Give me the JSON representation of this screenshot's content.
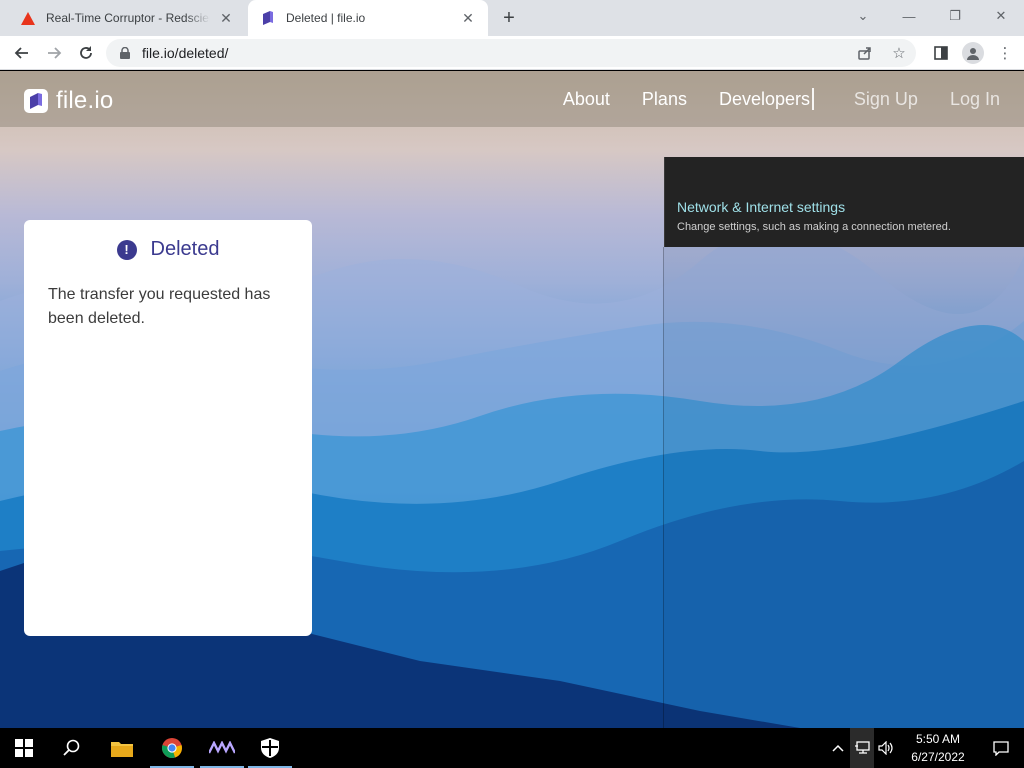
{
  "browser": {
    "tabs": [
      {
        "title": "Real-Time Corruptor - Redscientist",
        "favicon": "warning-triangle-icon",
        "active": false
      },
      {
        "title": "Deleted | file.io",
        "favicon": "fileio-favicon-icon",
        "active": true
      }
    ],
    "url": "file.io/deleted/"
  },
  "site": {
    "logo_text": "file.io",
    "nav": {
      "about": "About",
      "plans": "Plans",
      "developers": "Developers",
      "signup": "Sign Up",
      "login": "Log In"
    }
  },
  "card": {
    "title": "Deleted",
    "message": "The transfer you requested has been deleted."
  },
  "flyout": {
    "title": "Network & Internet settings",
    "description": "Change settings, such as making a connection metered."
  },
  "taskbar": {
    "time": "5:50 AM",
    "date": "6/27/2022",
    "apps": [
      "file-explorer-icon",
      "chrome-icon",
      "corruptor-app-icon",
      "security-shield-icon"
    ]
  },
  "colors": {
    "accent": "#3b3a8f",
    "flyout_link": "#9fe0e8"
  }
}
